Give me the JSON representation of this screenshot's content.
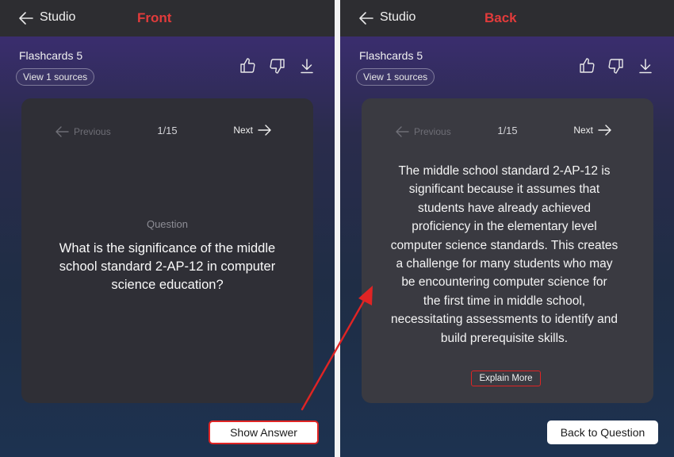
{
  "front": {
    "header": {
      "back_icon": "arrow-left-icon",
      "title": "Studio"
    },
    "side_label": "Front",
    "deck": {
      "title": "Flashcards 5",
      "sources_label": "View 1 sources"
    },
    "actions": [
      "thumbs-up-icon",
      "thumbs-down-icon",
      "download-icon"
    ],
    "card": {
      "prev_label": "Previous",
      "next_label": "Next",
      "counter": "1/15",
      "question_label": "Question",
      "question_text": "What is the significance of the middle school standard 2-AP-12 in computer science education?"
    },
    "button_label": "Show Answer"
  },
  "back": {
    "header": {
      "back_icon": "arrow-left-icon",
      "title": "Studio"
    },
    "side_label": "Back",
    "deck": {
      "title": "Flashcards 5",
      "sources_label": "View 1 sources"
    },
    "actions": [
      "thumbs-up-icon",
      "thumbs-down-icon",
      "download-icon"
    ],
    "card": {
      "prev_label": "Previous",
      "next_label": "Next",
      "counter": "1/15",
      "answer_text": "The middle school standard 2-AP-12 is\nsignificant because it assumes that\nstudents have already achieved\nproficiency in the elementary level\ncomputer science standards. This creates\na challenge for many students who may\nbe encountering computer science for\nthe first time in middle school,\nnecessitating assessments to identify and\nbuild prerequisite skills.",
      "explain_label": "Explain More"
    },
    "button_label": "Back to Question"
  },
  "colors": {
    "annotation_red": "#e02424",
    "label_red": "#e23b3b"
  }
}
